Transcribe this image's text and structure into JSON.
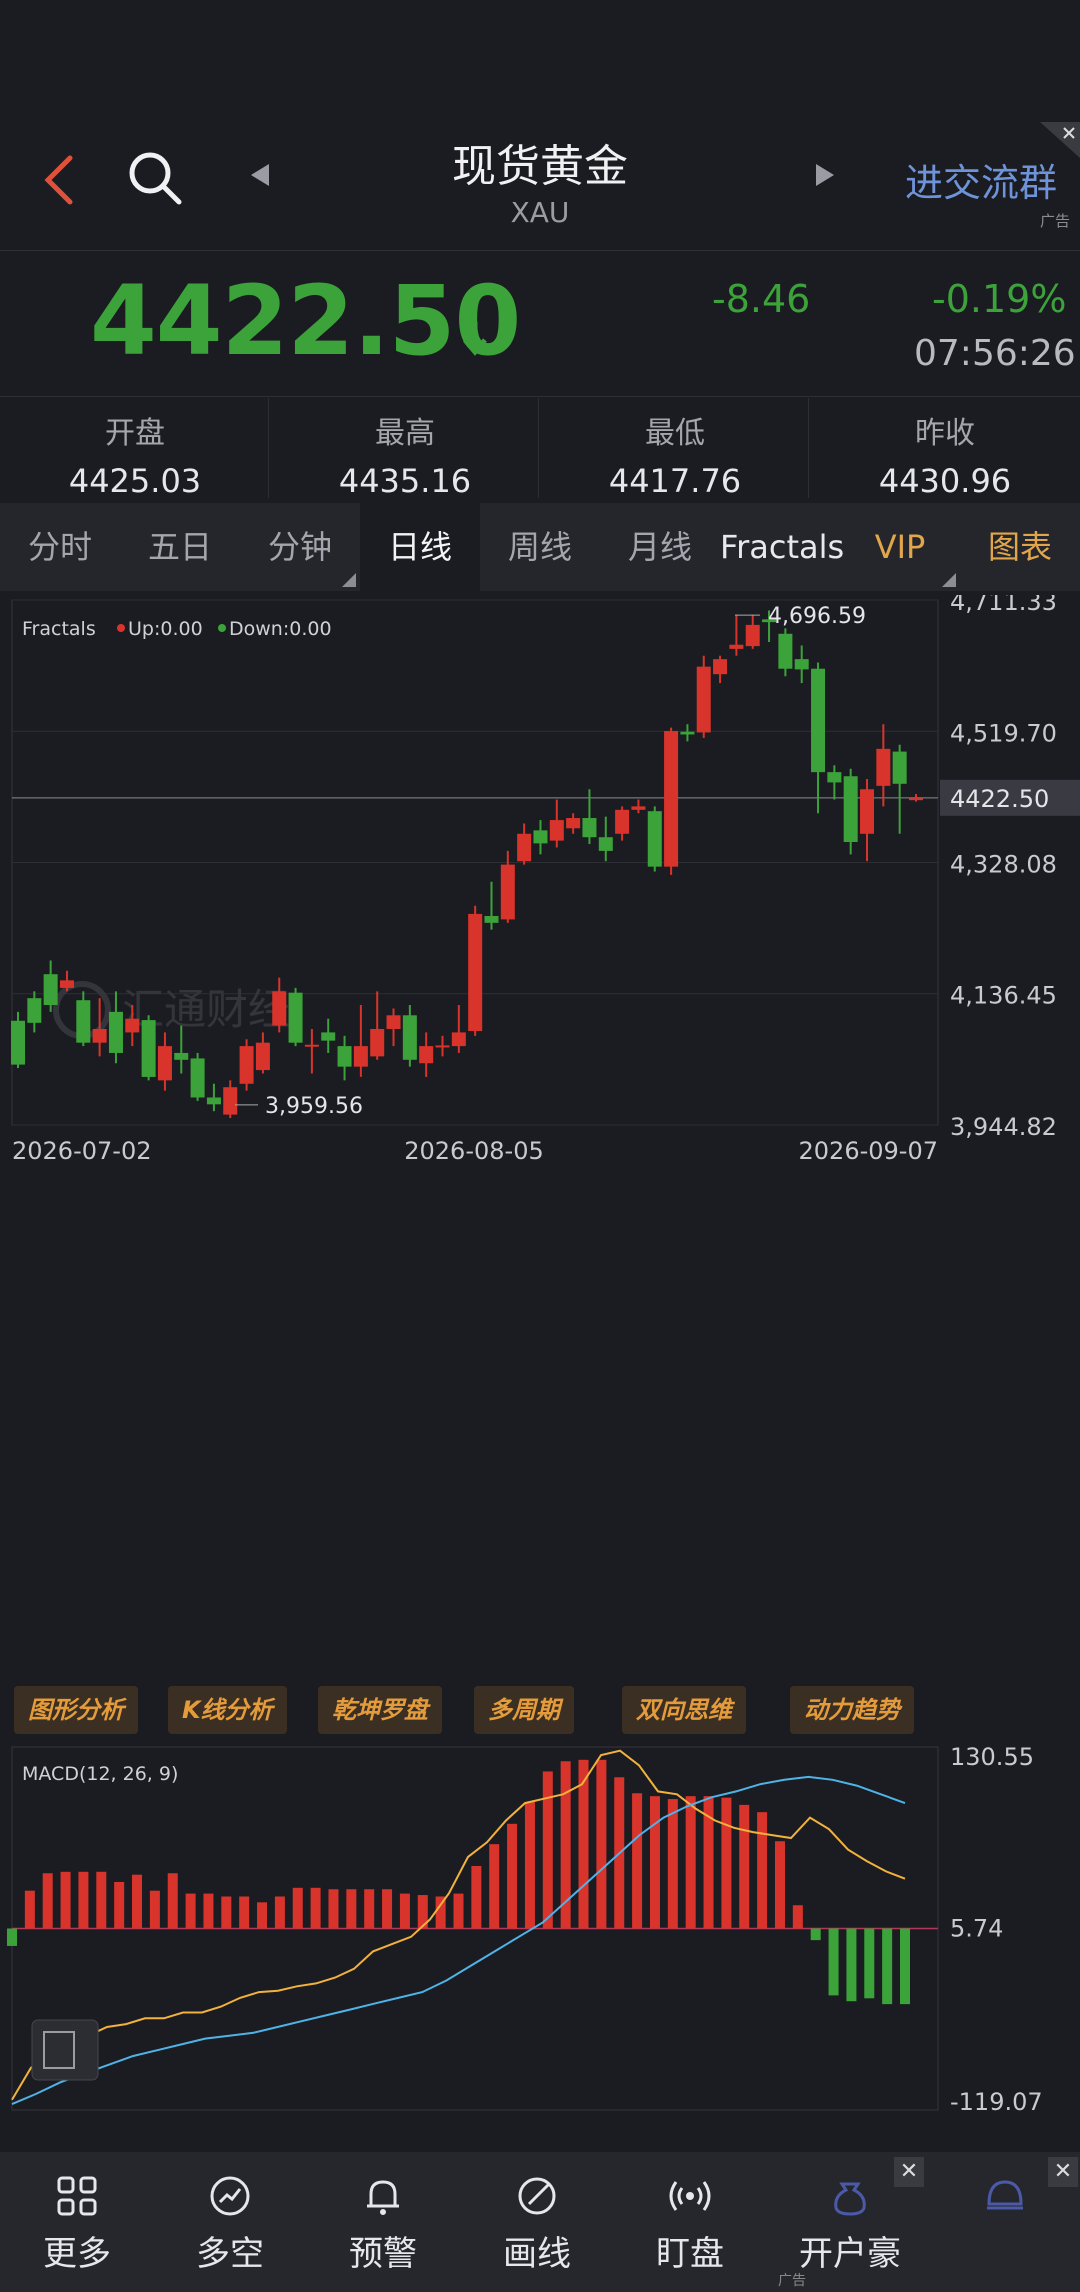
{
  "header": {
    "title": "现货黄金",
    "subtitle": "XAU",
    "ad_text": "进交流群",
    "ad_tag": "广告",
    "close": "✕"
  },
  "quote": {
    "price": "4422.50",
    "change": "-8.46",
    "change_pct": "-0.19%",
    "time": "07:56:26",
    "color_down": "#3ca33a",
    "color_up": "#d9342b"
  },
  "stats": [
    {
      "label": "开盘",
      "value": "4425.03"
    },
    {
      "label": "最高",
      "value": "4435.16"
    },
    {
      "label": "最低",
      "value": "4417.76"
    },
    {
      "label": "昨收",
      "value": "4430.96"
    }
  ],
  "tabs": [
    {
      "label": "分时"
    },
    {
      "label": "五日"
    },
    {
      "label": "分钟"
    },
    {
      "label": "日线"
    },
    {
      "label": "周线"
    },
    {
      "label": "月线"
    },
    {
      "label": "Fractals"
    },
    {
      "label": "VIP"
    },
    {
      "label": "图表"
    }
  ],
  "chart_data": [
    {
      "type": "candlestick",
      "indicator_label": "Fractals",
      "legend": [
        {
          "name": "Up:0.00",
          "color": "#d9342b"
        },
        {
          "name": "Down:0.00",
          "color": "#3ca33a"
        }
      ],
      "y_ticks": [
        "4,711.33",
        "4,519.70",
        "4,328.08",
        "4,136.45",
        "3,944.82"
      ],
      "ylim": [
        3944.82,
        4711.33
      ],
      "x_ticks": [
        "2026-07-02",
        "2026-08-05",
        "2026-09-07"
      ],
      "current_price": "4422.50",
      "high_label": "4,696.59",
      "low_label": "3,959.56",
      "watermark": "汇通财经",
      "candles": [
        [
          4097,
          4033,
          4110,
          4028
        ],
        [
          4130,
          4094,
          4140,
          4080
        ],
        [
          4165,
          4120,
          4185,
          4110
        ],
        [
          4145,
          4156,
          4170,
          4140
        ],
        [
          4127,
          4065,
          4140,
          4060
        ],
        [
          4065,
          4085,
          4130,
          4045
        ],
        [
          4110,
          4050,
          4140,
          4035
        ],
        [
          4080,
          4100,
          4120,
          4060
        ],
        [
          4098,
          4015,
          4105,
          4010
        ],
        [
          4010,
          4060,
          4080,
          3995
        ],
        [
          4050,
          4040,
          4090,
          4020
        ],
        [
          4042,
          3985,
          4050,
          3980
        ],
        [
          3985,
          3975,
          4005,
          3965
        ],
        [
          3960,
          4000,
          4010,
          3955
        ],
        [
          4005,
          4060,
          4070,
          3995
        ],
        [
          4025,
          4065,
          4080,
          4020
        ],
        [
          4090,
          4140,
          4160,
          4080
        ],
        [
          4138,
          4065,
          4145,
          4060
        ],
        [
          4060,
          4062,
          4085,
          4020
        ],
        [
          4080,
          4068,
          4100,
          4050
        ],
        [
          4060,
          4030,
          4075,
          4010
        ],
        [
          4030,
          4060,
          4120,
          4015
        ],
        [
          4045,
          4085,
          4140,
          4040
        ],
        [
          4085,
          4105,
          4115,
          4060
        ],
        [
          4105,
          4040,
          4120,
          4030
        ],
        [
          4035,
          4060,
          4080,
          4015
        ],
        [
          4060,
          4061,
          4075,
          4045
        ],
        [
          4060,
          4080,
          4120,
          4050
        ],
        [
          4082,
          4253,
          4265,
          4075
        ],
        [
          4250,
          4240,
          4300,
          4230
        ],
        [
          4245,
          4325,
          4345,
          4240
        ],
        [
          4330,
          4370,
          4385,
          4325
        ],
        [
          4375,
          4356,
          4390,
          4340
        ],
        [
          4360,
          4390,
          4420,
          4350
        ],
        [
          4378,
          4393,
          4400,
          4370
        ],
        [
          4393,
          4365,
          4435,
          4355
        ],
        [
          4365,
          4345,
          4395,
          4330
        ],
        [
          4370,
          4405,
          4410,
          4360
        ],
        [
          4405,
          4410,
          4420,
          4400
        ],
        [
          4403,
          4322,
          4410,
          4315
        ],
        [
          4322,
          4520,
          4525,
          4310
        ],
        [
          4519,
          4515,
          4530,
          4505
        ],
        [
          4518,
          4614,
          4630,
          4510
        ],
        [
          4603,
          4625,
          4630,
          4590
        ],
        [
          4640,
          4646,
          4690,
          4630
        ],
        [
          4644,
          4675,
          4690,
          4640
        ],
        [
          4683,
          4679,
          4696,
          4650
        ],
        [
          4662,
          4611,
          4670,
          4600
        ],
        [
          4625,
          4610,
          4645,
          4590
        ],
        [
          4611,
          4460,
          4620,
          4400
        ],
        [
          4460,
          4445,
          4470,
          4420
        ],
        [
          4454,
          4358,
          4465,
          4340
        ],
        [
          4370,
          4435,
          4450,
          4330
        ],
        [
          4440,
          4494,
          4530,
          4410
        ],
        [
          4490,
          4443,
          4500,
          4370
        ],
        [
          4420,
          4422,
          4428,
          4417
        ]
      ]
    },
    {
      "type": "macd",
      "label": "MACD(12, 26, 9)",
      "y_ticks": [
        "130.55",
        "5.74",
        "-119.07"
      ],
      "ylim": [
        -119.07,
        130.55
      ],
      "histogram": [
        -12,
        26,
        38,
        39,
        39,
        39,
        32,
        37,
        26,
        38,
        24,
        24,
        22,
        22,
        18,
        22,
        28,
        28,
        27,
        27,
        27,
        27,
        24,
        23,
        22,
        24,
        43,
        58,
        72,
        87,
        108,
        115,
        116,
        116,
        104,
        93,
        91,
        89,
        91,
        91,
        90,
        85,
        80,
        60,
        16,
        -8,
        -46,
        -50,
        -48,
        -52,
        -52
      ],
      "dif": [
        -112,
        -90,
        -80,
        -72,
        -68,
        -62,
        -60,
        -56,
        -56,
        -52,
        -52,
        -48,
        -42,
        -38,
        -37,
        -34,
        -32,
        -28,
        -22,
        -10,
        -5,
        0,
        12,
        30,
        55,
        65,
        80,
        92,
        95,
        98,
        105,
        125,
        128,
        118,
        100,
        98,
        88,
        80,
        75,
        72,
        70,
        68,
        82,
        74,
        60,
        52,
        45,
        40
      ],
      "dea": [
        -115,
        -108,
        -100,
        -94,
        -88,
        -82,
        -78,
        -74,
        -70,
        -68,
        -66,
        -62,
        -58,
        -54,
        -50,
        -46,
        -42,
        -38,
        -30,
        -20,
        -10,
        0,
        10,
        25,
        40,
        55,
        70,
        82,
        90,
        96,
        100,
        105,
        108,
        110,
        108,
        104,
        98,
        92
      ]
    }
  ],
  "tools": [
    "图形分析",
    "K线分析",
    "乾坤罗盘",
    "多周期",
    "双向思维",
    "动力趋势"
  ],
  "bottom_nav": [
    {
      "label": "更多",
      "icon": "grid-icon"
    },
    {
      "label": "多空",
      "icon": "trend-icon"
    },
    {
      "label": "预警",
      "icon": "bell-icon"
    },
    {
      "label": "画线",
      "icon": "draw-icon"
    },
    {
      "label": "盯盘",
      "icon": "broadcast-icon"
    },
    {
      "label": "开户豪",
      "icon": "moneybag-icon"
    }
  ],
  "bottom_ad_tag": "广告"
}
